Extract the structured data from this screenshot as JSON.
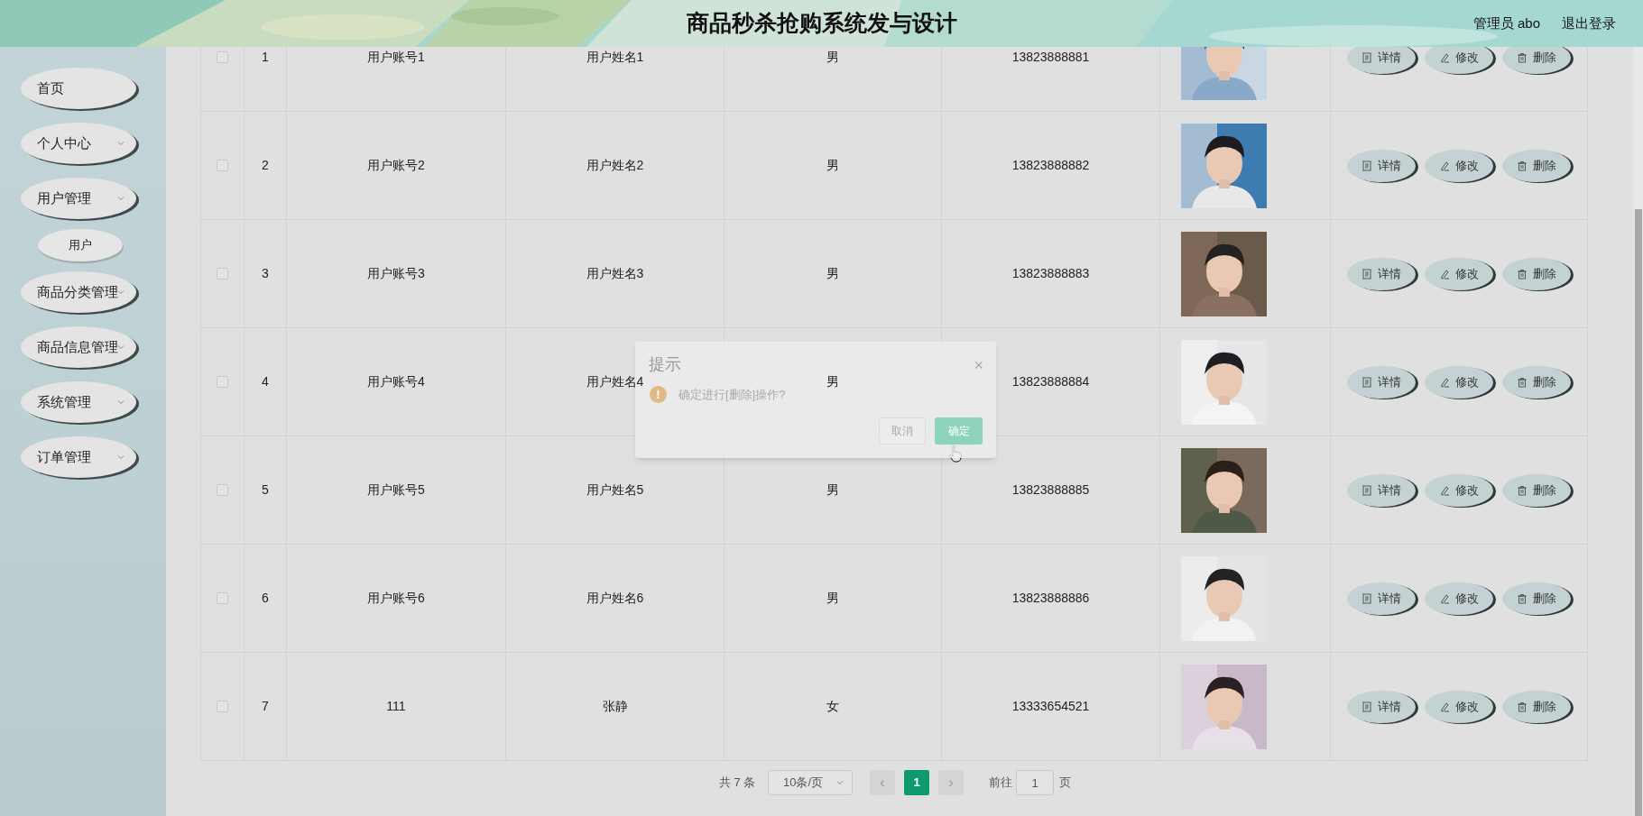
{
  "header": {
    "title": "商品秒杀抢购系统发与设计",
    "user": "管理员 abo",
    "logout": "退出登录"
  },
  "sidebar": {
    "items": [
      {
        "kind": "link",
        "label": "首页"
      },
      {
        "kind": "submenu",
        "label": "个人中心"
      },
      {
        "kind": "submenu",
        "label": "用户管理",
        "children": [
          {
            "label": "用户"
          }
        ]
      },
      {
        "kind": "submenu",
        "label": "商品分类管理"
      },
      {
        "kind": "submenu",
        "label": "商品信息管理"
      },
      {
        "kind": "submenu",
        "label": "系统管理"
      },
      {
        "kind": "submenu",
        "label": "订单管理"
      }
    ]
  },
  "table": {
    "rows": [
      {
        "checked": false,
        "index": "1",
        "account": "用户账号1",
        "name": "用户姓名1",
        "gender": "男",
        "phone": "13823888881",
        "actions": [
          {
            "kind": "detail",
            "label": "详情"
          },
          {
            "kind": "edit",
            "label": "修改"
          },
          {
            "kind": "delete",
            "label": "删除"
          }
        ]
      },
      {
        "checked": false,
        "index": "2",
        "account": "用户账号2",
        "name": "用户姓名2",
        "gender": "男",
        "phone": "13823888882",
        "actions": [
          {
            "kind": "detail",
            "label": "详情"
          },
          {
            "kind": "edit",
            "label": "修改"
          },
          {
            "kind": "delete",
            "label": "删除"
          }
        ]
      },
      {
        "checked": false,
        "index": "3",
        "account": "用户账号3",
        "name": "用户姓名3",
        "gender": "男",
        "phone": "13823888883",
        "actions": [
          {
            "kind": "detail",
            "label": "详情"
          },
          {
            "kind": "edit",
            "label": "修改"
          },
          {
            "kind": "delete",
            "label": "删除"
          }
        ]
      },
      {
        "checked": false,
        "index": "4",
        "account": "用户账号4",
        "name": "用户姓名4",
        "gender": "男",
        "phone": "13823888884",
        "actions": [
          {
            "kind": "detail",
            "label": "详情"
          },
          {
            "kind": "edit",
            "label": "修改"
          },
          {
            "kind": "delete",
            "label": "删除"
          }
        ]
      },
      {
        "checked": false,
        "index": "5",
        "account": "用户账号5",
        "name": "用户姓名5",
        "gender": "男",
        "phone": "13823888885",
        "actions": [
          {
            "kind": "detail",
            "label": "详情"
          },
          {
            "kind": "edit",
            "label": "修改"
          },
          {
            "kind": "delete",
            "label": "删除"
          }
        ]
      },
      {
        "checked": false,
        "index": "6",
        "account": "用户账号6",
        "name": "用户姓名6",
        "gender": "男",
        "phone": "13823888886",
        "actions": [
          {
            "kind": "detail",
            "label": "详情"
          },
          {
            "kind": "edit",
            "label": "修改"
          },
          {
            "kind": "delete",
            "label": "删除"
          }
        ]
      },
      {
        "checked": false,
        "index": "7",
        "account": "111",
        "name": "张静",
        "gender": "女",
        "phone": "13333654521",
        "actions": [
          {
            "kind": "detail",
            "label": "详情"
          },
          {
            "kind": "edit",
            "label": "修改"
          },
          {
            "kind": "delete",
            "label": "删除"
          }
        ]
      }
    ]
  },
  "pagination": {
    "total": "共 7 条",
    "page_size": "10条/页",
    "prev": "‹",
    "pages": [
      {
        "label": "1",
        "selected": true
      }
    ],
    "next": "›",
    "goto": "前往",
    "goto_value": "1",
    "page_unit": "页"
  },
  "dialog": {
    "title": "提示",
    "close": "×",
    "icon": "!",
    "message": "确定进行[删除]操作?",
    "cancel": "取消",
    "confirm": "确定"
  }
}
